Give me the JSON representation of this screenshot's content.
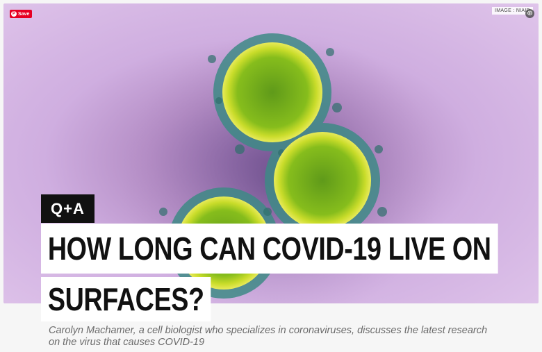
{
  "hero": {
    "save_label": "Save",
    "pin_glyph": "P",
    "credit": "IMAGE : NIAID",
    "expand_glyph": "⊕"
  },
  "article": {
    "badge": "Q+A",
    "headline_line1": "HOW LONG CAN COVID-19 LIVE ON",
    "headline_line2": "SURFACES?",
    "dek": "Carolyn Machamer, a cell biologist who specializes in coronaviruses, discusses the latest research on the virus that causes COVID-19"
  },
  "colors": {
    "pinterest_red": "#e60023",
    "virus_green": "#7fb61f",
    "background_purple": "#cfaee0"
  }
}
